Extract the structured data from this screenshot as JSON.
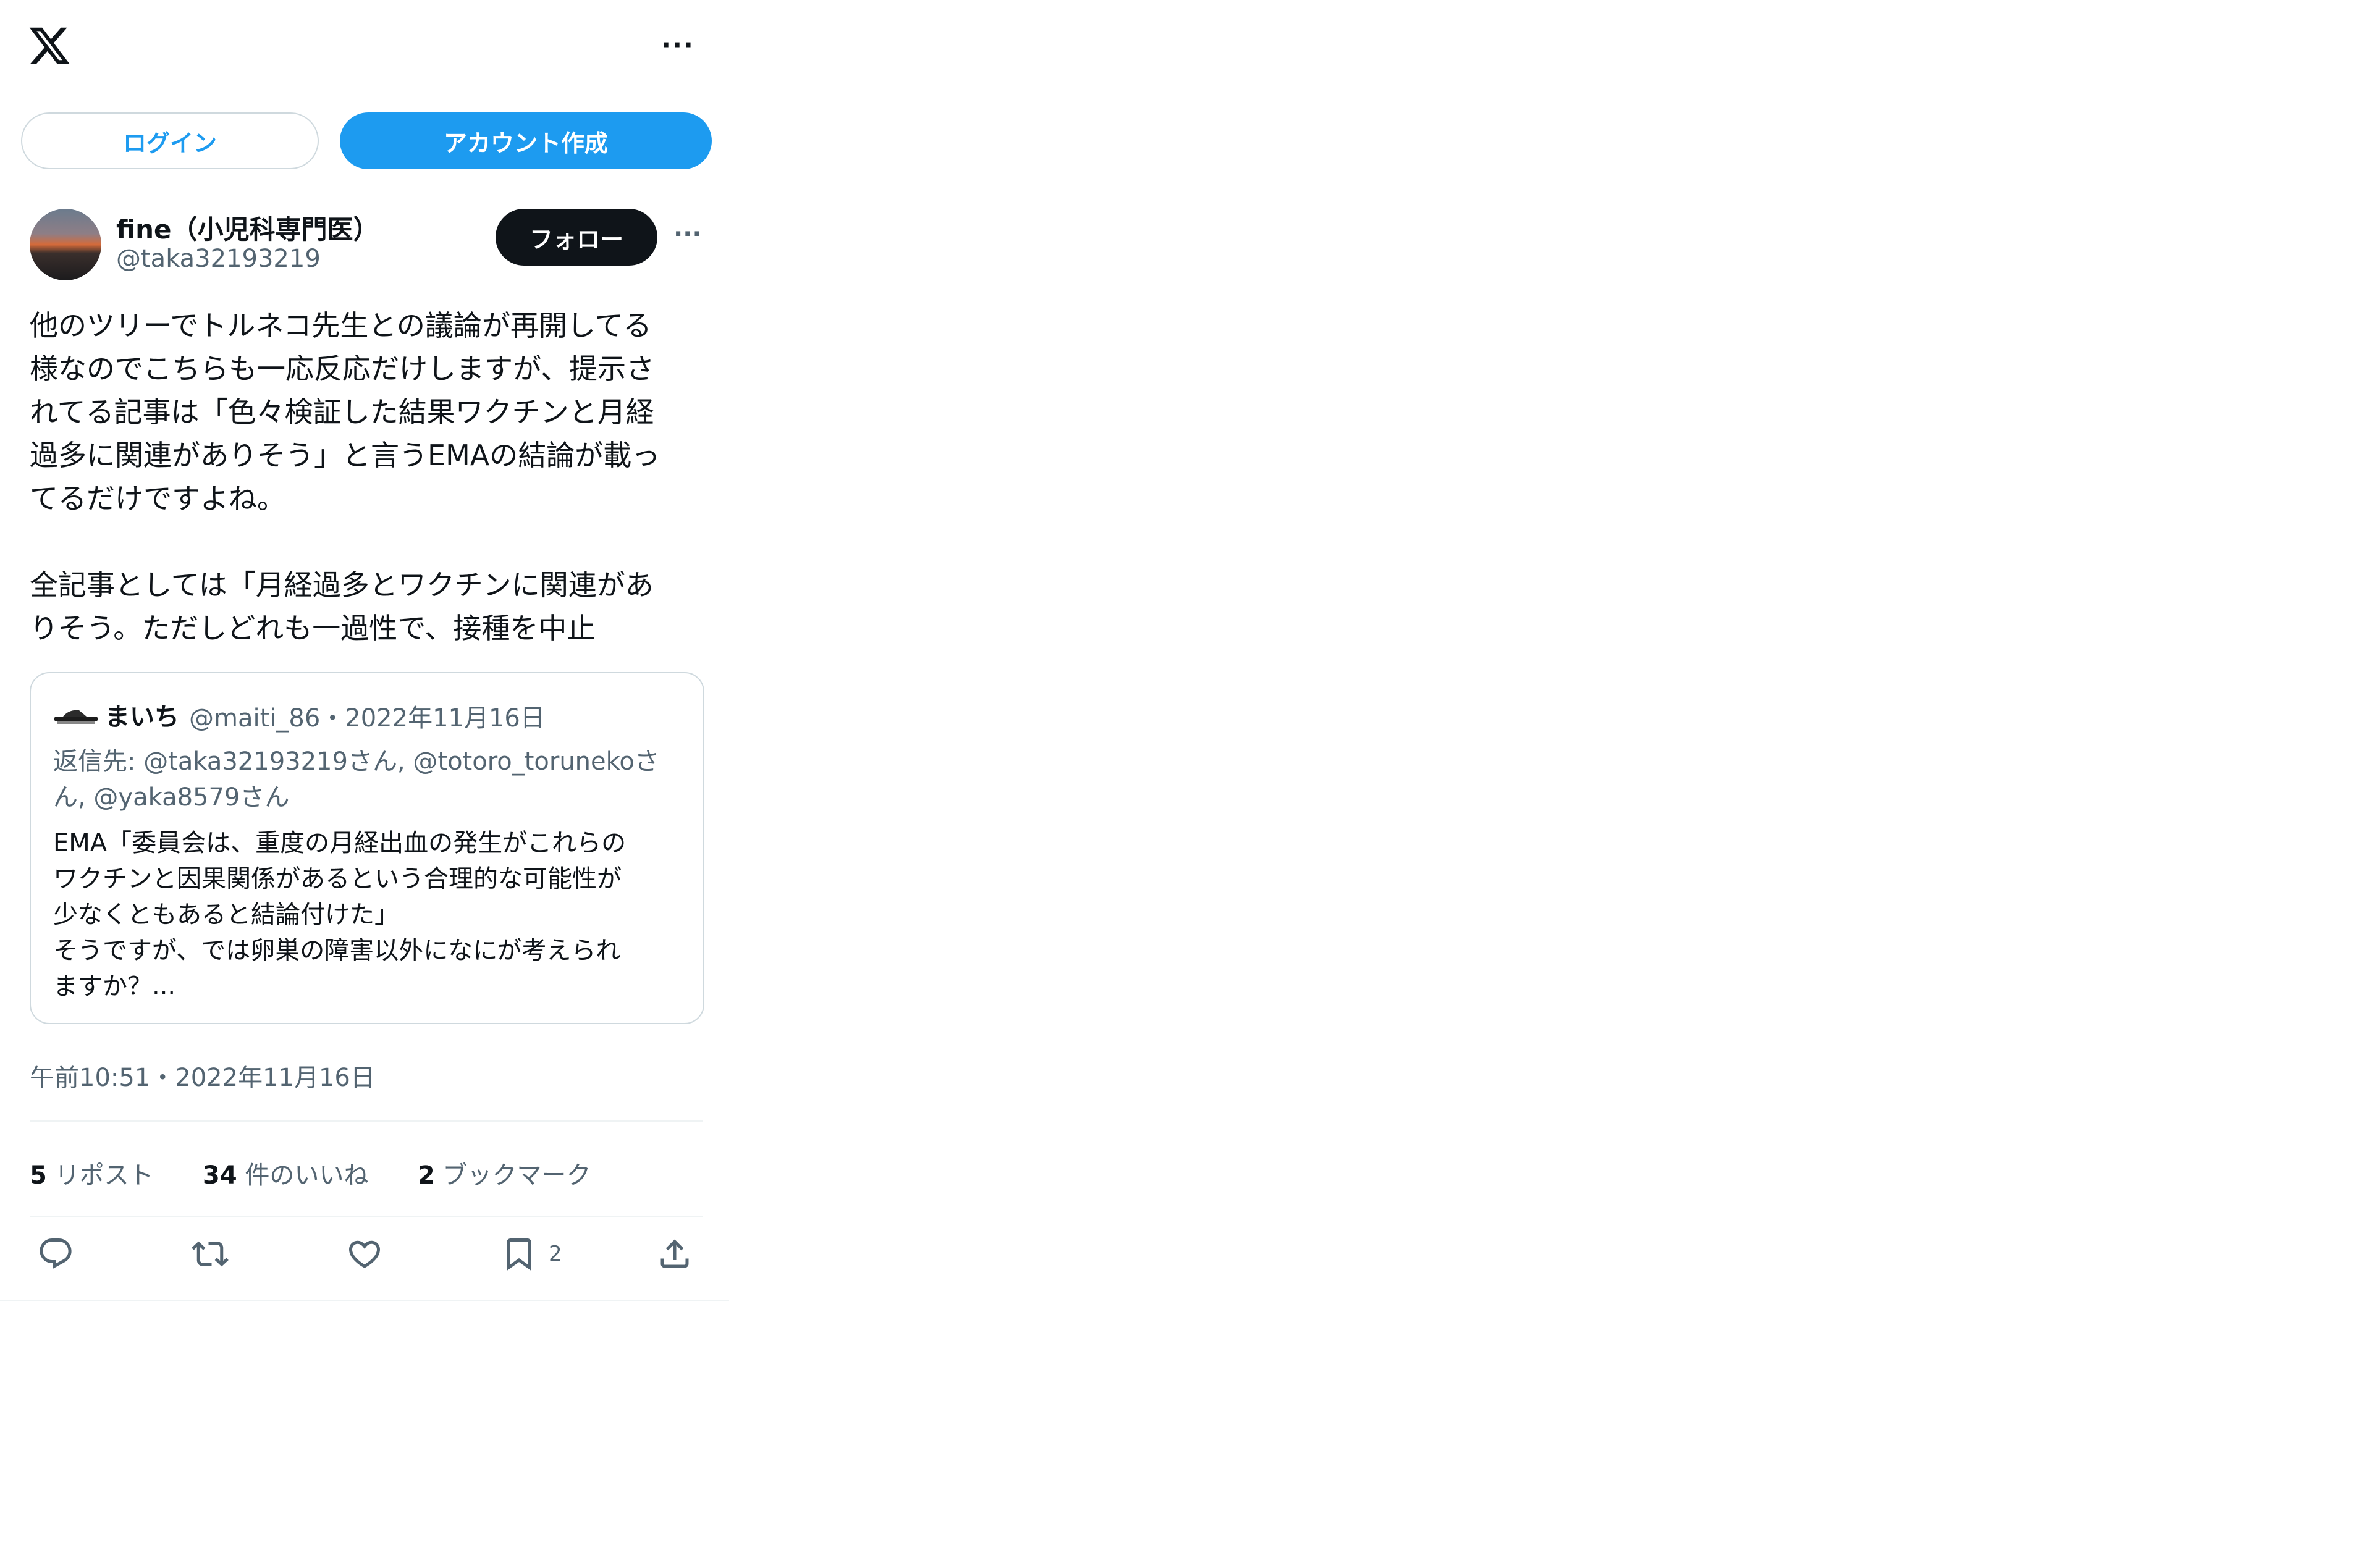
{
  "header": {
    "logo": "x-logo",
    "more": "···"
  },
  "auth": {
    "login_label": "ログイン",
    "signup_label": "アカウント作成"
  },
  "post": {
    "author_name": "fine（小児科専門医）",
    "author_handle": "@taka32193219",
    "follow_label": "フォロー",
    "more": "···",
    "text": "他のツリーでトルネコ先生との議論が再開してる\n様なのでこちらも一応反応だけしますが、提示さ\nれてる記事は「色々検証した結果ワクチンと月経\n過多に関連がありそう」と言うEMAの結論が載っ\nてるだけですよね。\n\n全記事としては「月経過多とワクチンに関連があ\nりそう。ただしどれも一過性で、接種を中止",
    "timestamp": "午前10:51・2022年11月16日"
  },
  "quote": {
    "author_name": "まいち",
    "author_handle_date": "@maiti_86・2022年11月16日",
    "reply_to": "返信先: @taka32193219さん, @totoro_torunekoさん, @yaka8579さん",
    "text": "EMA「委員会は、重度の月経出血の発生がこれらの\nワクチンと因果関係があるという合理的な可能性が\n少なくともあると結論付けた」\nそうですが、では卵巣の障害以外になにが考えられ\nますか？..."
  },
  "stats": {
    "reposts_count": "5",
    "reposts_label": "リポスト",
    "likes_count": "34",
    "likes_label": "件のいいね",
    "bookmarks_count": "2",
    "bookmarks_label": "ブックマーク"
  },
  "actions": {
    "reply_icon": "reply-icon",
    "repost_icon": "repost-icon",
    "like_icon": "heart-icon",
    "bookmark_icon": "bookmark-icon",
    "bookmark_count": "2",
    "share_icon": "share-icon"
  },
  "colors": {
    "accent": "#1d9bf0",
    "text": "#0f1419",
    "muted": "#536471",
    "border": "#cfd9de"
  }
}
